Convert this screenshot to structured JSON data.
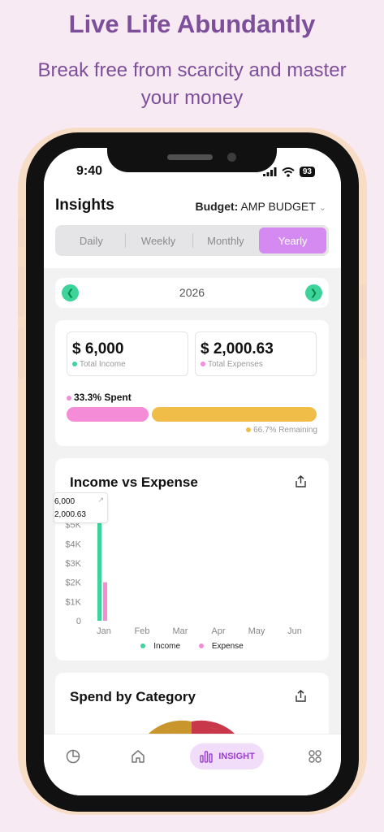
{
  "marketing": {
    "headline": "Live Life Abundantly",
    "subline": "Break free from scarcity and master your money"
  },
  "status_bar": {
    "time": "9:40",
    "battery": "93"
  },
  "header": {
    "title": "Insights",
    "budget_label": "Budget:",
    "budget_name": "AMP BUDGET"
  },
  "period_tabs": [
    {
      "label": "Daily"
    },
    {
      "label": "Weekly"
    },
    {
      "label": "Monthly"
    },
    {
      "label": "Yearly",
      "active": true
    }
  ],
  "year_selector": {
    "year": "2026"
  },
  "summary": {
    "total_income_amount": "$ 6,000",
    "total_income_label": "Total Income",
    "total_expenses_amount": "$ 2,000.63",
    "total_expenses_label": "Total Expenses",
    "spent_label": "33.3% Spent",
    "remaining_label": "66.7% Remaining",
    "spent_fraction": 0.333
  },
  "income_chart": {
    "title": "Income vs Expense",
    "tooltip_income": "6,000",
    "tooltip_expense": "2,000.63",
    "legend_income": "Income",
    "legend_expense": "Expense"
  },
  "chart_data": {
    "type": "bar",
    "title": "Income vs Expense",
    "categories": [
      "Jan",
      "Feb",
      "Mar",
      "Apr",
      "May",
      "Jun"
    ],
    "series": [
      {
        "name": "Income",
        "values": [
          6000,
          0,
          0,
          0,
          0,
          0
        ]
      },
      {
        "name": "Expense",
        "values": [
          2000.63,
          0,
          0,
          0,
          0,
          0
        ]
      }
    ],
    "y_ticks": [
      "0",
      "$1K",
      "$2K",
      "$3K",
      "$4K",
      "$5K"
    ],
    "ylim": [
      0,
      6000
    ],
    "colors": {
      "Income": "#3ed39a",
      "Expense": "#f58cd8"
    },
    "legend_position": "bottom",
    "grid": false
  },
  "category_card": {
    "title": "Spend by Category"
  },
  "tab_bar": {
    "active_label": "INSIGHT"
  },
  "colors": {
    "accent_purple": "#d58af2",
    "income_green": "#3ed39a",
    "expense_pink": "#f58cd8",
    "remaining_yellow": "#f0be48",
    "brand_text": "#7d4f9b"
  },
  "icons": {
    "prev": "chevron-left-icon",
    "next": "chevron-right-icon",
    "share": "share-icon",
    "tab_reports": "pie-chart-icon",
    "tab_home": "home-icon",
    "tab_insight": "bar-chart-icon",
    "tab_more": "grid-icon"
  }
}
